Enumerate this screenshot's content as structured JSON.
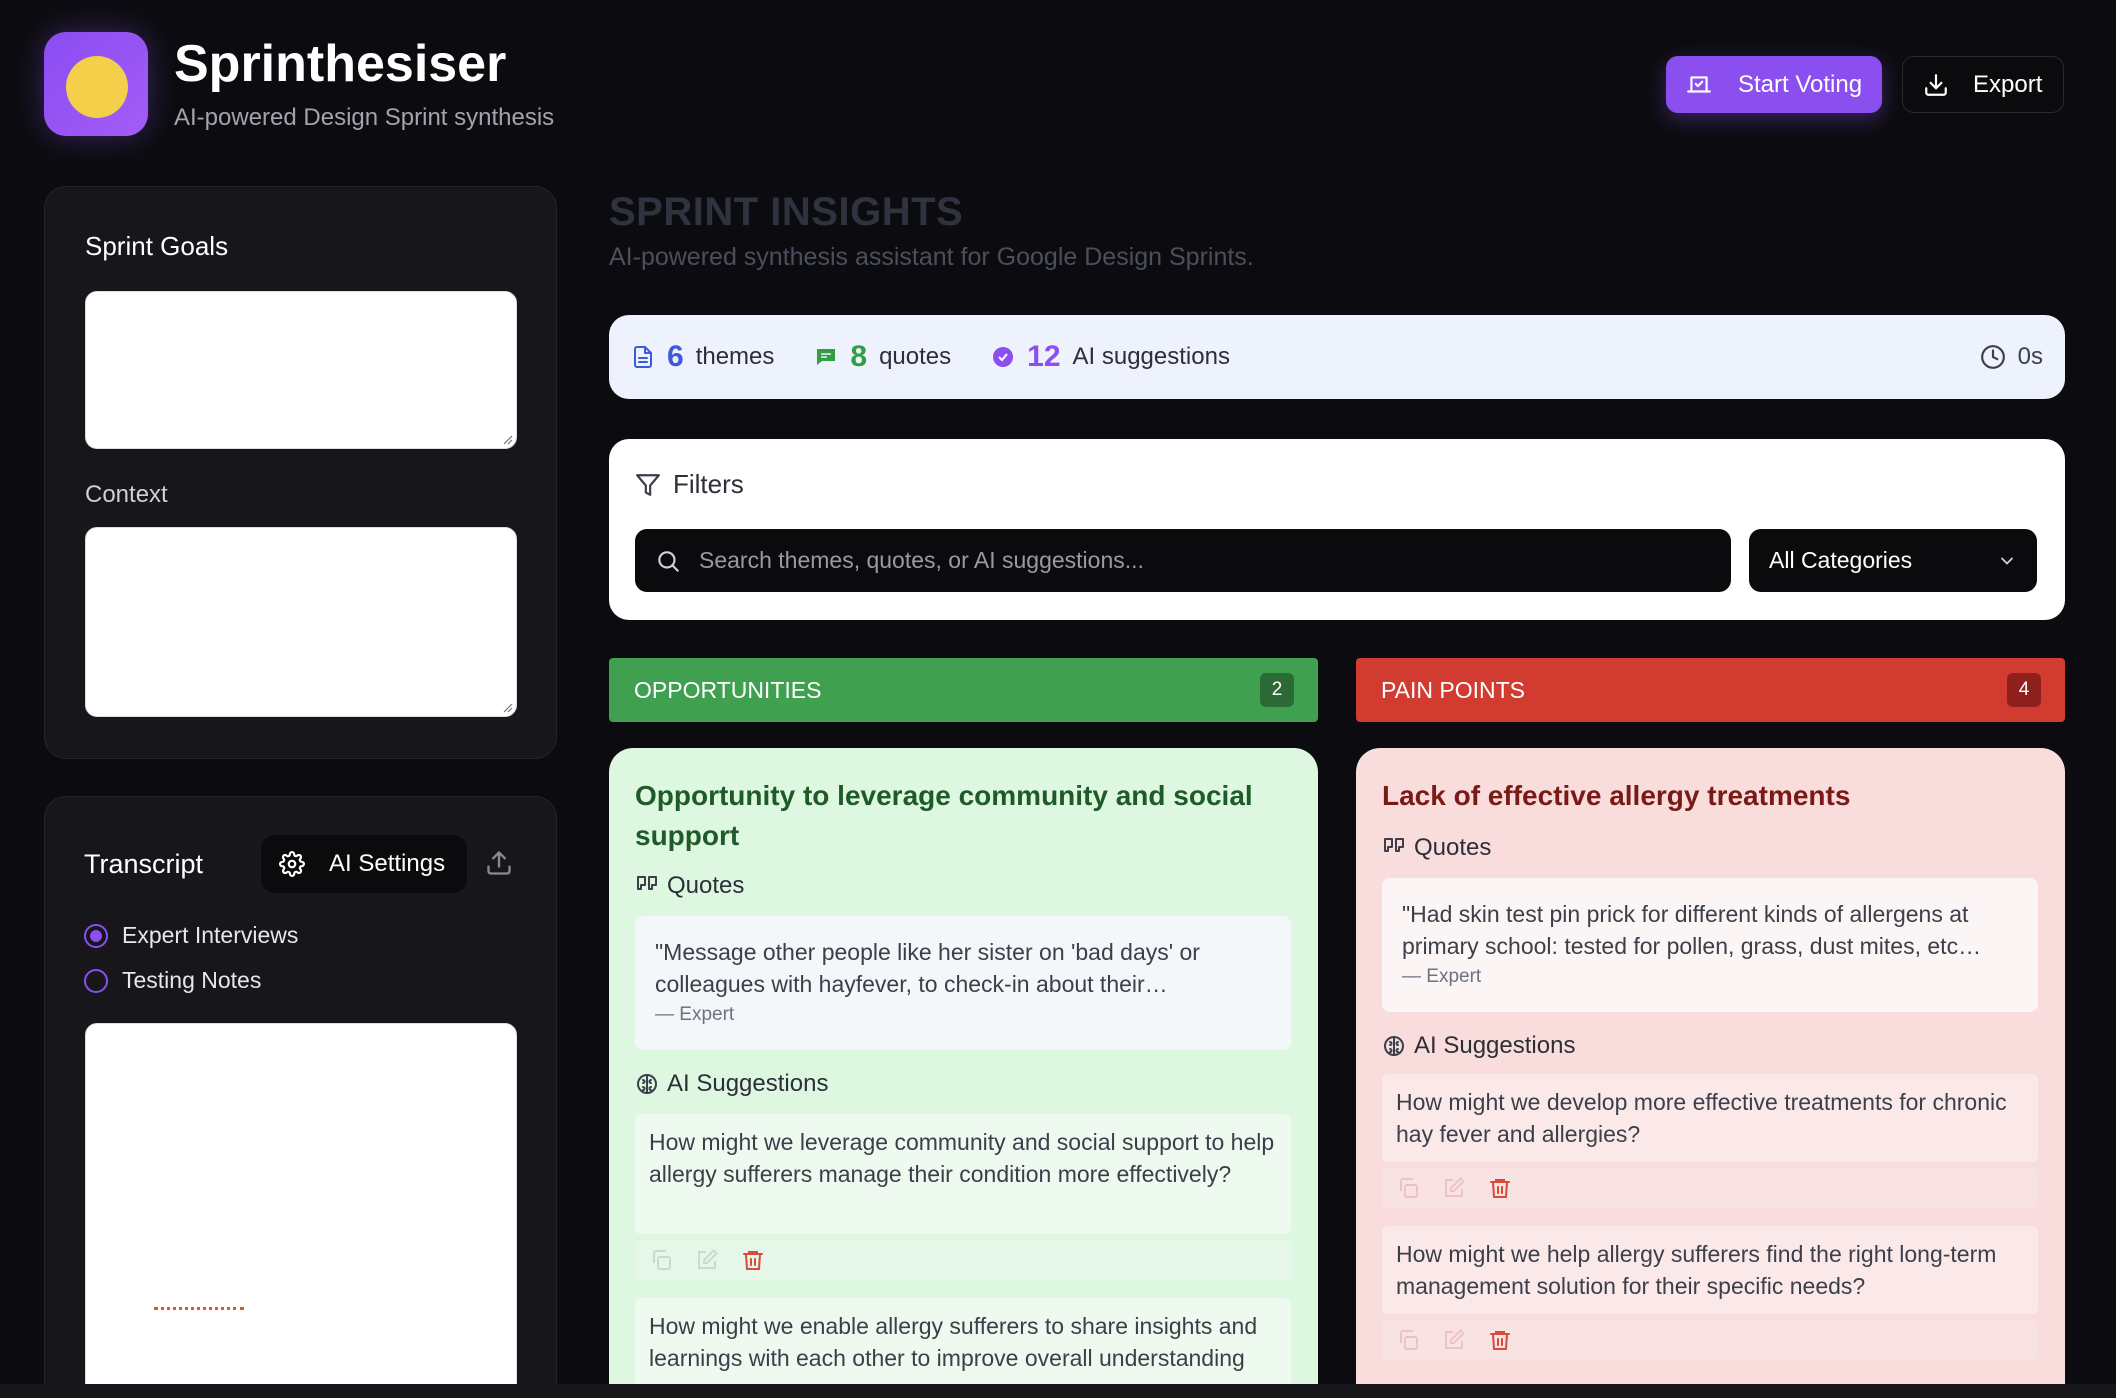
{
  "app": {
    "title": "Sprinthesiser",
    "subtitle": "AI-powered Design Sprint synthesis",
    "logo_colors": {
      "tile": "#8b4ff0",
      "dot": "#f3cf4a"
    }
  },
  "header": {
    "start_voting_label": "Start Voting",
    "export_label": "Export"
  },
  "sidebar": {
    "goals_label": "Sprint Goals",
    "goals_value": "",
    "context_label": "Context",
    "context_value": "",
    "transcript_label": "Transcript",
    "ai_settings_label": "AI Settings",
    "transcript_types": [
      {
        "label": "Expert Interviews",
        "selected": true
      },
      {
        "label": "Testing Notes",
        "selected": false
      }
    ],
    "transcript_value": ""
  },
  "main": {
    "title": "SPRINT INSIGHTS",
    "subtitle": "AI-powered synthesis assistant for Google Design Sprints."
  },
  "stats": {
    "themes_count": "6",
    "themes_label": "themes",
    "quotes_count": "8",
    "quotes_label": "quotes",
    "suggestions_count": "12",
    "suggestions_label": "AI suggestions",
    "elapsed": "0s",
    "colors": {
      "themes": "#3b5bdb",
      "quotes": "#2f9e44",
      "suggestions": "#8b4ff0"
    }
  },
  "filters": {
    "title": "Filters",
    "search_placeholder": "Search themes, quotes, or AI suggestions...",
    "category_selected": "All Categories"
  },
  "columns": {
    "opportunities": {
      "label": "OPPORTUNITIES",
      "count": "2",
      "color": "#3fa14f",
      "card": {
        "title": "Opportunity to leverage community and social support",
        "quotes_label": "Quotes",
        "quote_text": "\"Message other people like her sister on 'bad days' or colleagues with hayfever, to check-in about their…",
        "quote_author": "— Expert",
        "suggestions_label": "AI Suggestions",
        "suggestions": [
          "How might we leverage community and social support to help allergy sufferers manage their condition more effectively?",
          "How might we enable allergy sufferers to share insights and learnings with each other to improve overall understanding"
        ]
      }
    },
    "pain_points": {
      "label": "PAIN POINTS",
      "count": "4",
      "color": "#d23b30",
      "card": {
        "title": "Lack of effective allergy treatments",
        "quotes_label": "Quotes",
        "quote_text": "\"Had skin test pin prick for different kinds of allergens at primary school: tested for pollen, grass, dust mites, etc…",
        "quote_author": "— Expert",
        "suggestions_label": "AI Suggestions",
        "suggestions": [
          "How might we develop more effective treatments for chronic hay fever and allergies?",
          "How might we help allergy sufferers find the right long-term management solution for their specific needs?"
        ]
      }
    }
  }
}
